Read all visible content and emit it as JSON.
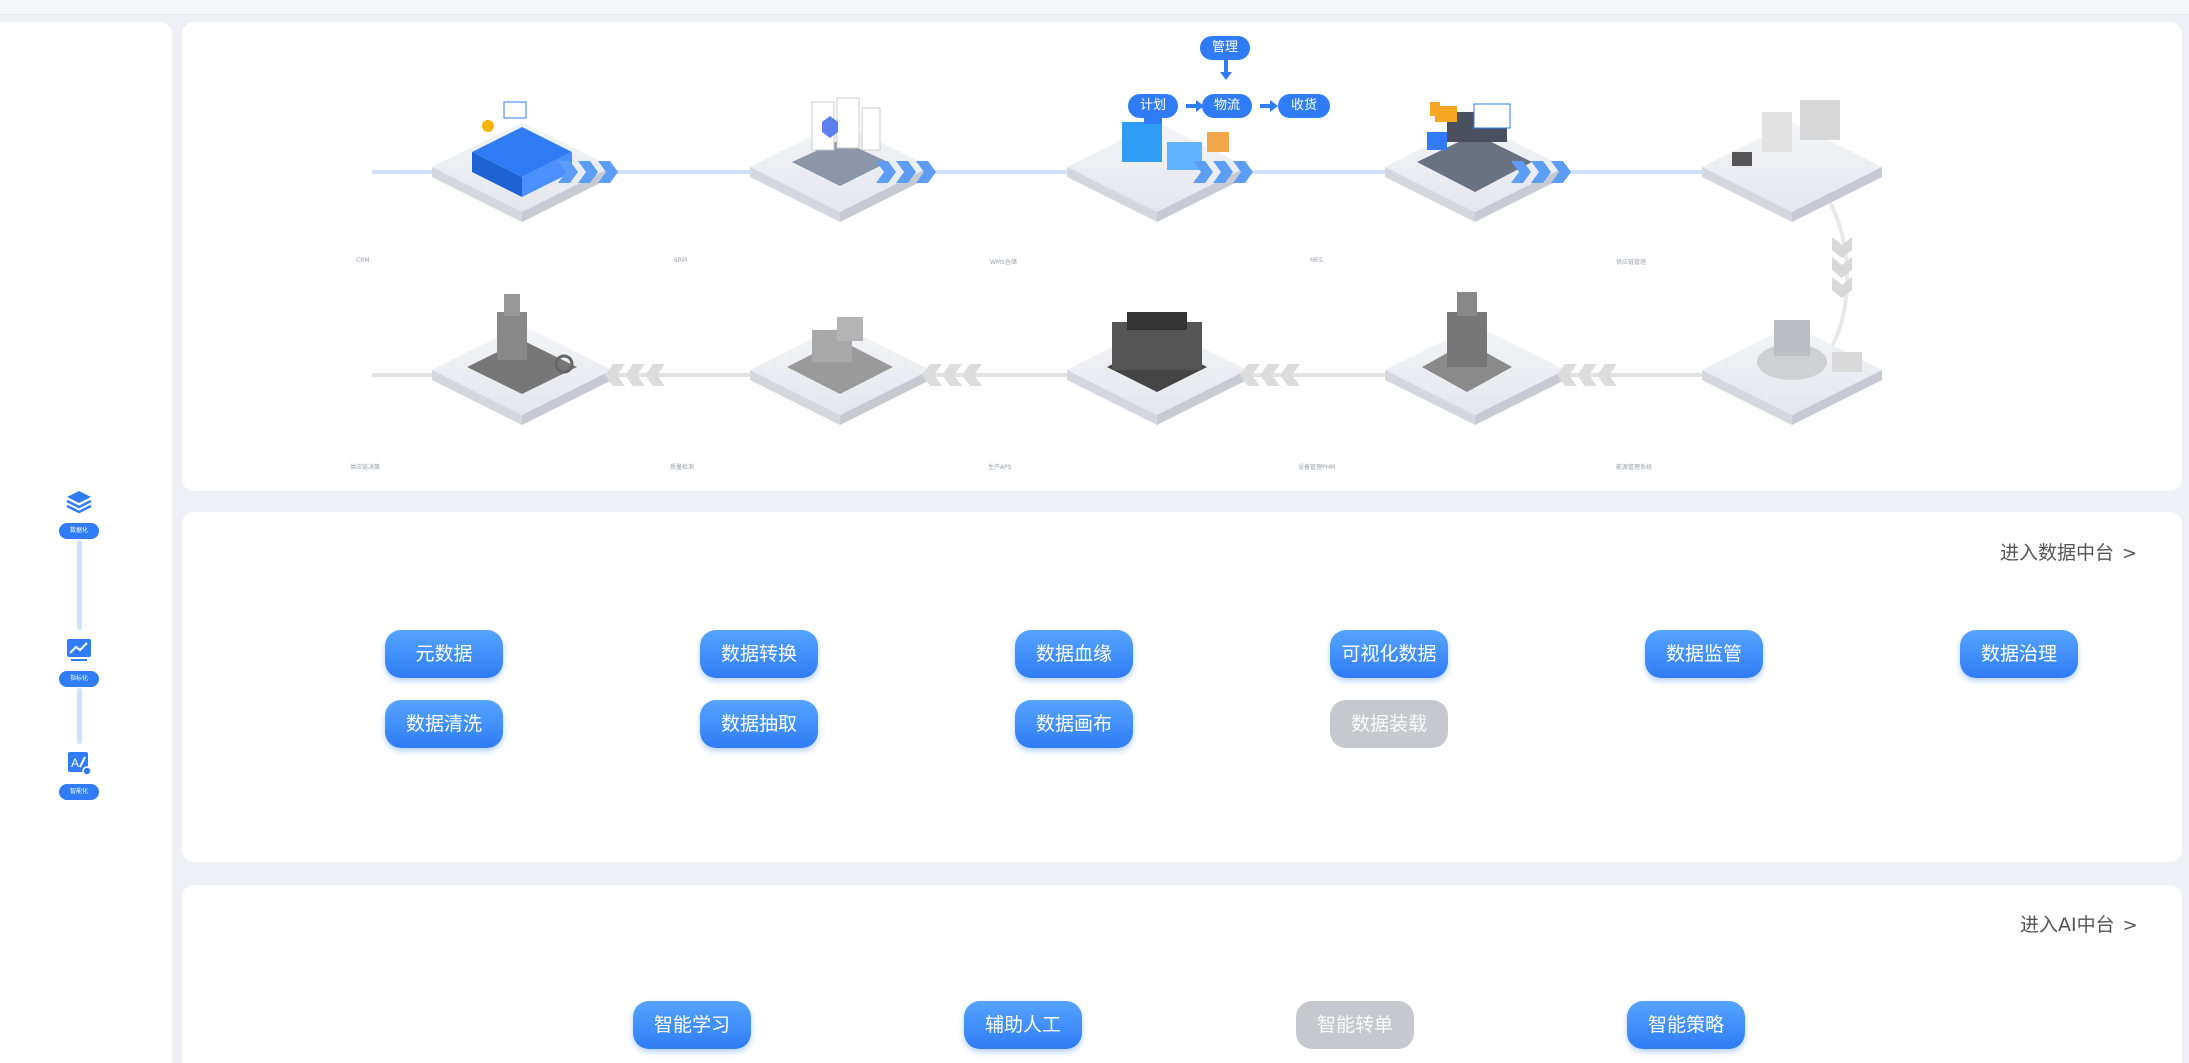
{
  "sidebar": {
    "steps": [
      {
        "icon": "layers-icon",
        "label": "数据化"
      },
      {
        "icon": "chart-icon",
        "label": "指标化"
      },
      {
        "icon": "ai-icon",
        "label": "智能化"
      }
    ]
  },
  "flow": {
    "management": {
      "top": "管理",
      "left": "计划",
      "center": "物流",
      "right": "收货"
    },
    "row1_labels": [
      "CRM",
      "SRM",
      "WMS仓储",
      "MES",
      "供应链管理"
    ],
    "row2_labels": [
      "供应链决策",
      "质量检测",
      "生产APS",
      "设备管理PHM",
      "能源管理系统"
    ]
  },
  "data_platform": {
    "link_label": "进入数据中台",
    "buttons": [
      {
        "label": "元数据",
        "disabled": false
      },
      {
        "label": "数据转换",
        "disabled": false
      },
      {
        "label": "数据血缘",
        "disabled": false
      },
      {
        "label": "可视化数据",
        "disabled": false
      },
      {
        "label": "数据监管",
        "disabled": false
      },
      {
        "label": "数据治理",
        "disabled": false
      },
      {
        "label": "数据清洗",
        "disabled": false
      },
      {
        "label": "数据抽取",
        "disabled": false
      },
      {
        "label": "数据画布",
        "disabled": false
      },
      {
        "label": "数据装载",
        "disabled": true
      }
    ]
  },
  "ai_platform": {
    "link_label": "进入AI中台",
    "buttons": [
      {
        "label": "智能学习",
        "disabled": false
      },
      {
        "label": "辅助人工",
        "disabled": false
      },
      {
        "label": "智能转单",
        "disabled": true
      },
      {
        "label": "智能策略",
        "disabled": false
      }
    ]
  },
  "colors": {
    "accent": "#2f7cf6",
    "disabled": "#c6c8cd",
    "panel": "#ffffff",
    "background": "#eef0f5"
  }
}
